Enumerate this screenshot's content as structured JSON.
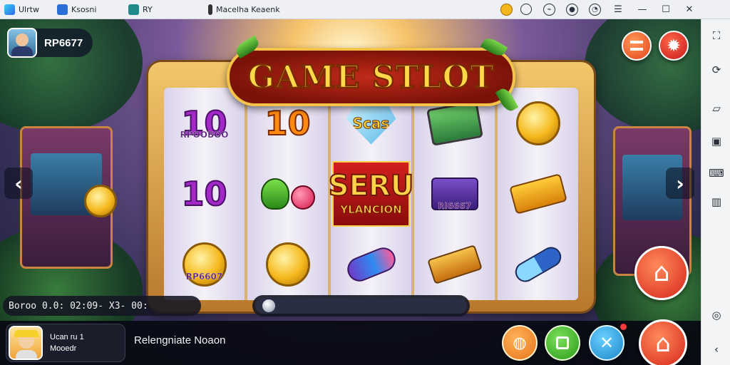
{
  "window": {
    "tabs": [
      {
        "label": "Ulrtw",
        "icon": "app-icon",
        "color": "#2f8df0"
      },
      {
        "label": "Ksosni",
        "icon": "window-icon",
        "color": "#2b6fd6"
      },
      {
        "label": "RY",
        "icon": "bluestacks-icon",
        "color": "#1f8a8a"
      },
      {
        "label": "Macelha Keaenk",
        "icon": "doc-icon",
        "color": "#333333"
      }
    ],
    "controls": [
      "coin-icon",
      "avatar-icon",
      "gift-icon",
      "settings-icon",
      "hamburger-icon",
      "minimize-icon",
      "maximize-icon",
      "close-icon"
    ]
  },
  "sidebar": {
    "icons": [
      "fullscreen-icon",
      "rotate-icon",
      "shake-icon",
      "screenshot-icon",
      "keyboard-icon",
      "volume-icon",
      "back-icon"
    ]
  },
  "player": {
    "name": "RP6677"
  },
  "logo": {
    "title": "GAME STLOT"
  },
  "reels": [
    [
      {
        "type": "number",
        "text": "10",
        "caption": "RPOOBOO",
        "color": "#a228c8"
      },
      {
        "type": "number",
        "text": "10",
        "color": "#a228c8"
      },
      {
        "type": "coin",
        "caption": "RP6607"
      }
    ],
    [
      {
        "type": "number",
        "text": "10",
        "color": "#ff8a12"
      },
      {
        "type": "cherry"
      },
      {
        "type": "coin"
      }
    ],
    [
      {
        "type": "gem",
        "text": "Scas"
      },
      {
        "type": "red-panel",
        "big": "SERU",
        "small": "YLANCION"
      },
      {
        "type": "candy"
      }
    ],
    [
      {
        "type": "chest"
      },
      {
        "type": "box",
        "caption": "RI6667"
      },
      {
        "type": "cash"
      }
    ],
    [
      {
        "type": "coin"
      },
      {
        "type": "ticket"
      },
      {
        "type": "cap"
      }
    ]
  ],
  "ticker": {
    "text": "Boroo 0.0: 02:09- X3- 00:"
  },
  "progress": {
    "value": 0.03
  },
  "bottom": {
    "user_line1": "Ucan ru 1",
    "user_line2": "Mooedr",
    "status": "Relengniate Noaon"
  },
  "buttons": {
    "menu": "menu-icon",
    "settings": "gear-icon",
    "home_large": "home-icon",
    "b1": "coin-icon",
    "b2": "stop-icon",
    "b3": "tools-icon",
    "b4": "home-icon"
  },
  "colors": {
    "accent_red": "#e63b1f",
    "accent_orange": "#f07a1a",
    "green": "#3fae2a",
    "blue": "#2596d4"
  }
}
